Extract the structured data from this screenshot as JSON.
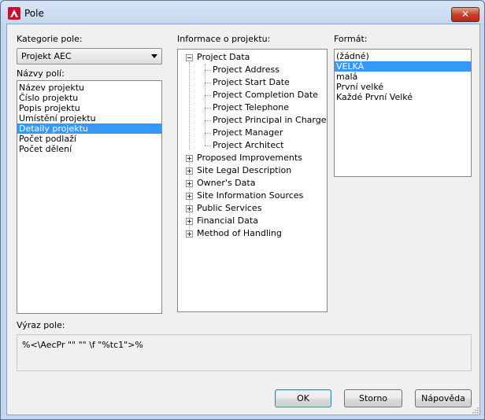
{
  "window": {
    "title": "Pole"
  },
  "category": {
    "label": "Kategorie pole:",
    "value": "Projekt AEC"
  },
  "field_names": {
    "label": "Názvy polí:",
    "items": [
      "Název projektu",
      "Číslo projektu",
      "Popis projektu",
      "Umístění projektu",
      "Detaily projektu",
      "Počet podlaží",
      "Počet dělení"
    ],
    "selected_index": 4
  },
  "project_info": {
    "label": "Informace o projektu:",
    "root": "Project Data",
    "children": [
      "Project Address",
      "Project Start Date",
      "Project Completion Date",
      "Project Telephone",
      "Project Principal in Charge",
      "Project Manager",
      "Project Architect"
    ],
    "groups": [
      "Proposed Improvements",
      "Site Legal Description",
      "Owner's Data",
      "Site Information Sources",
      "Public Services",
      "Financial Data",
      "Method of Handling"
    ]
  },
  "format": {
    "label": "Formát:",
    "items": [
      "(žádné)",
      "VELKÁ",
      "malá",
      "První velké",
      "Každé První Velké"
    ],
    "selected_index": 1
  },
  "expression": {
    "label": "Výraz pole:",
    "value": "%<\\AecPr \"\" \"\" \\f \"%tc1\">%"
  },
  "buttons": {
    "ok": "OK",
    "cancel": "Storno",
    "help": "Nápověda"
  }
}
